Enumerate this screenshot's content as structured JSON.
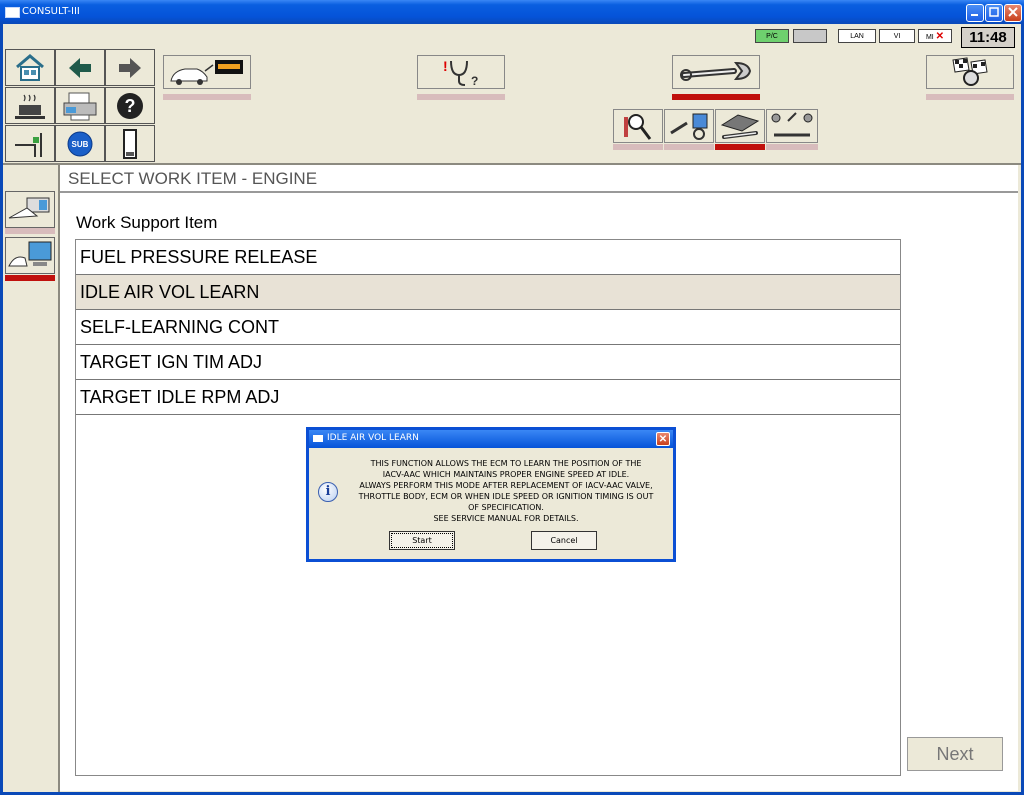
{
  "window": {
    "title": "CONSULT-III",
    "controls": [
      "minimize",
      "maximize",
      "close"
    ]
  },
  "status": {
    "clock": "11:48",
    "lan_label": "LAN",
    "vi_label": "VI",
    "mi_label": "MI",
    "indicator_label": "P/C"
  },
  "toolbar": {
    "buttons": [
      "home-icon",
      "back-arrow-icon",
      "forward-arrow-icon",
      "print-icon",
      "printer-icon",
      "help-icon",
      "screen-capture-icon",
      "sub-icon",
      "battery-icon"
    ],
    "sub_label": "SUB",
    "help_label": "?",
    "top_buttons": [
      "vehicle-selection-icon",
      "diagnosis-icon",
      "repair-icon",
      "racing-flag-icon"
    ],
    "sub_buttons": [
      "data-monitor-icon",
      "ecu-reprogram-icon",
      "work-support-icon",
      "special-function-icon"
    ],
    "active_color": "#c0100c",
    "inactive_color": "#d8bcbc"
  },
  "sidebar": {
    "items": [
      "engine-module-icon",
      "computer-icon"
    ]
  },
  "main": {
    "header": "SELECT WORK ITEM - ENGINE",
    "section_label": "Work Support Item",
    "items": [
      "FUEL PRESSURE RELEASE",
      "IDLE AIR VOL LEARN",
      "SELF-LEARNING CONT",
      "TARGET IGN TIM ADJ",
      "TARGET IDLE RPM ADJ"
    ],
    "selected_index": 1,
    "next_label": "Next"
  },
  "dialog": {
    "title": "IDLE AIR VOL LEARN",
    "lines": [
      "THIS FUNCTION ALLOWS THE ECM TO LEARN THE POSITION OF THE",
      "IACV-AAC WHICH MAINTAINS PROPER ENGINE SPEED AT IDLE.",
      "ALWAYS PERFORM THIS MODE AFTER REPLACEMENT OF IACV-AAC VALVE,",
      "THROTTLE BODY, ECM OR WHEN IDLE SPEED OR IGNITION TIMING IS OUT",
      "OF SPECIFICATION.",
      "SEE SERVICE MANUAL FOR DETAILS."
    ],
    "start_label": "Start",
    "cancel_label": "Cancel",
    "icon": "info-icon"
  }
}
